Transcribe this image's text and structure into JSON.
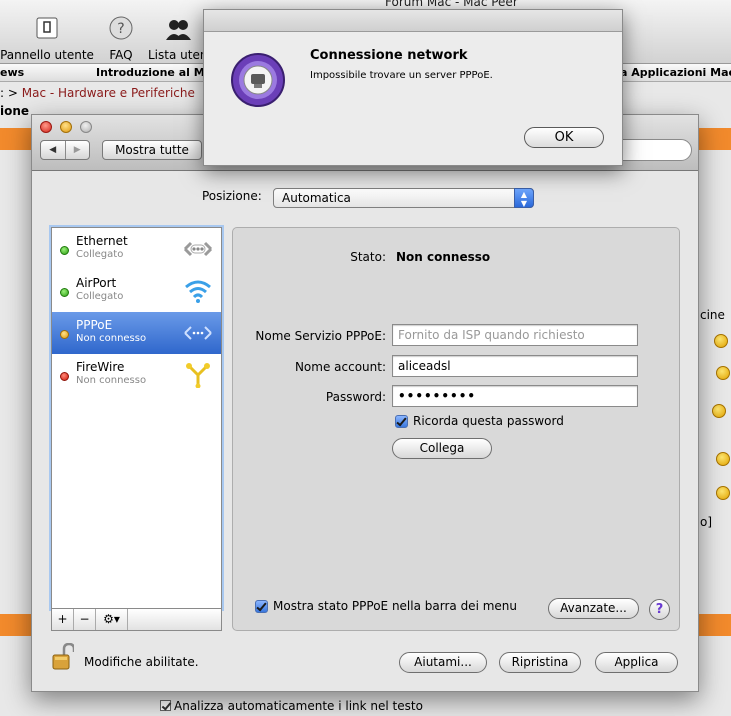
{
  "background": {
    "top_title": "Forum Mac - Mac Peer",
    "toolbar": [
      {
        "label": "Pannello utente",
        "icon": "user-panel-icon"
      },
      {
        "label": "FAQ",
        "icon": "faq-icon"
      },
      {
        "label": "Lista utenti",
        "icon": "users-icon"
      }
    ],
    "nav": {
      "left": "ews",
      "middle": "Introduzione al Ma",
      "right": "a Applicazioni Mac"
    },
    "breadcrumb": {
      "prefix": ": >",
      "link": "Mac - Hardware e Periferiche"
    },
    "section": "ione",
    "side_text": "cine",
    "side_bracket": "o]",
    "footer_checkbox": "Analizza automaticamente i link nel testo"
  },
  "window": {
    "show_all": "Mostra tutte",
    "location": {
      "label": "Posizione:",
      "value": "Automatica"
    },
    "services": [
      {
        "name": "Ethernet",
        "status": "Collegato",
        "dot": "green",
        "icon": "ethernet-icon"
      },
      {
        "name": "AirPort",
        "status": "Collegato",
        "dot": "green",
        "icon": "airport-wifi-icon"
      },
      {
        "name": "PPPoE",
        "status": "Non connesso",
        "dot": "yellow",
        "icon": "pppoe-icon",
        "selected": true
      },
      {
        "name": "FireWire",
        "status": "Non connesso",
        "dot": "red",
        "icon": "firewire-icon"
      }
    ],
    "list_tools": {
      "add": "+",
      "remove": "−",
      "gear": "⚙▾"
    },
    "detail": {
      "status_label": "Stato:",
      "status_value": "Non connesso",
      "service_name_label": "Nome Servizio PPPoE:",
      "service_name_placeholder": "Fornito da ISP quando richiesto",
      "account_label": "Nome account:",
      "account_value": "aliceadsl",
      "password_label": "Password:",
      "password_value": "•••••••••",
      "remember_label": "Ricorda questa password",
      "connect_button": "Collega",
      "show_status_label": "Mostra stato PPPoE nella barra dei menu",
      "advanced_button": "Avanzate...",
      "help": "?"
    },
    "footer": {
      "lock_label": "Modifiche abilitate.",
      "assist_button": "Aiutami...",
      "revert_button": "Ripristina",
      "apply_button": "Applica"
    }
  },
  "dialog": {
    "title": "Connessione network",
    "message": "Impossibile trovare un server PPPoE.",
    "ok": "OK"
  },
  "colors": {
    "accent": "#2f67cc",
    "orange": "#f28a2c"
  }
}
